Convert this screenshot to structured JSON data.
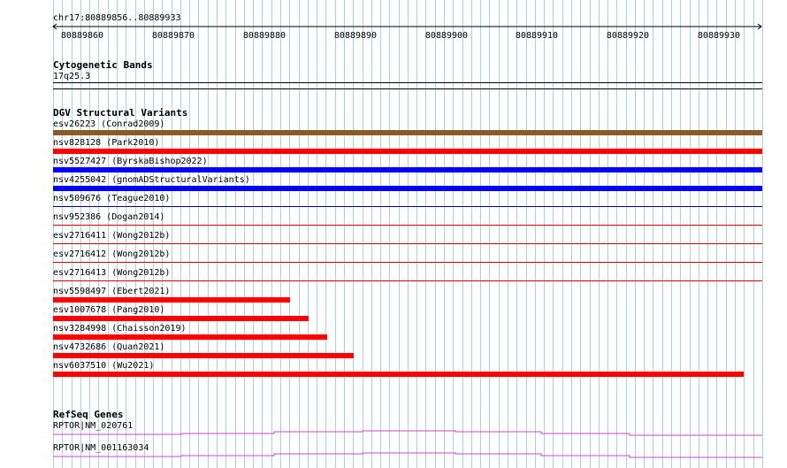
{
  "ruler": {
    "position": "chr17:80889856..80889933",
    "ticks": [
      "80889860",
      "80889870",
      "80889880",
      "80889890",
      "80889900",
      "80889910",
      "80889920",
      "80889930"
    ]
  },
  "cytoband": {
    "title": "Cytogenetic Bands",
    "band": "17q25.3"
  },
  "dgv": {
    "title": "DGV Structural Variants",
    "items": [
      {
        "label": "esv26223 (Conrad2009)",
        "color": "#8b5a2b",
        "thick": true,
        "end_fraction": 1.0
      },
      {
        "label": "nsv828128 (Park2010)",
        "color": "#ff0000",
        "thick": true,
        "end_fraction": 1.0
      },
      {
        "label": "nsv5527427 (ByrskaBishop2022)",
        "color": "#0000ff",
        "thick": true,
        "end_fraction": 1.0
      },
      {
        "label": "nsv4255042 (gnomADStructuralVariants)",
        "color": "#0000ff",
        "thick": true,
        "end_fraction": 1.0
      },
      {
        "label": "nsv509676 (Teague2010)",
        "color": "#000080",
        "thick": false,
        "end_fraction": 1.0
      },
      {
        "label": "nsv952386 (Dogan2014)",
        "color": "#cc0000",
        "thick": false,
        "end_fraction": 1.0
      },
      {
        "label": "esv2716411 (Wong2012b)",
        "color": "#cc0000",
        "thick": false,
        "end_fraction": 1.0
      },
      {
        "label": "esv2716412 (Wong2012b)",
        "color": "#cc0000",
        "thick": false,
        "end_fraction": 1.0
      },
      {
        "label": "esv2716413 (Wong2012b)",
        "color": "#cc0000",
        "thick": false,
        "end_fraction": 1.0
      },
      {
        "label": "nsv5598497 (Ebert2021)",
        "color": "#ff0000",
        "thick": true,
        "end_fraction": 0.3345
      },
      {
        "label": "esv1007678 (Pang2010)",
        "color": "#ff0000",
        "thick": true,
        "end_fraction": 0.3604
      },
      {
        "label": "nsv3284998 (Chaisson2019)",
        "color": "#ff0000",
        "thick": true,
        "end_fraction": 0.3866
      },
      {
        "label": "nsv4732686 (Quan2021)",
        "color": "#ff0000",
        "thick": true,
        "end_fraction": 0.4245
      },
      {
        "label": "nsv6037510 (Wu2021)",
        "color": "#ff0000",
        "thick": true,
        "end_fraction": 0.9743
      }
    ]
  },
  "refseq": {
    "title": "RefSeq Genes",
    "color": "#cc44cc",
    "genes": [
      {
        "label": "RPTOR|NM_020761"
      },
      {
        "label": "RPTOR|NM_001163034"
      }
    ]
  },
  "colors": {
    "grid": "#a8d4e0",
    "axis": "#000000"
  }
}
